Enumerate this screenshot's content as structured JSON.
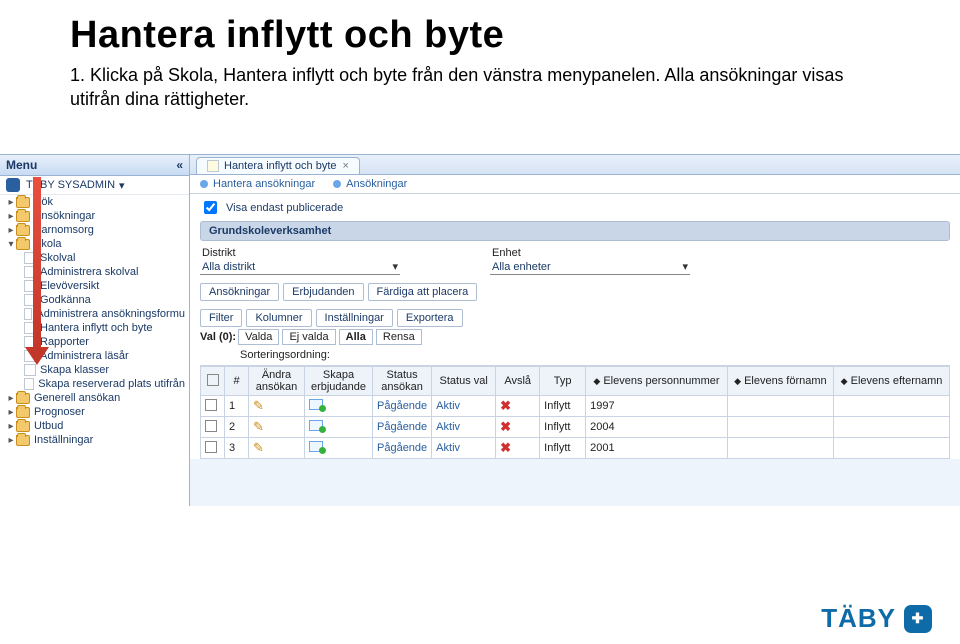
{
  "heading": "Hantera inflytt och byte",
  "paragraph": "1. Klicka på Skola, Hantera inflytt och byte från den vänstra menypanelen. Alla ansökningar visas utifrån dina rättigheter.",
  "logo_text": "TÄBY",
  "sidebar": {
    "menu_label": "Menu",
    "user": "TÄBY SYSADMIN",
    "items": [
      {
        "label": "Sök",
        "type": "folder",
        "level": 1,
        "expand": "▸"
      },
      {
        "label": "Ansökningar",
        "type": "folder",
        "level": 1,
        "expand": "▸"
      },
      {
        "label": "Barnomsorg",
        "type": "folder",
        "level": 1,
        "expand": "▸"
      },
      {
        "label": "Skola",
        "type": "folder",
        "level": 1,
        "expand": "▾"
      },
      {
        "label": "Skolval",
        "type": "leaf",
        "level": 2
      },
      {
        "label": "Administrera skolval",
        "type": "leaf",
        "level": 2
      },
      {
        "label": "Elevöversikt",
        "type": "leaf",
        "level": 2
      },
      {
        "label": "Godkänna",
        "type": "leaf",
        "level": 2
      },
      {
        "label": "Administrera ansökningsformu",
        "type": "leaf",
        "level": 2
      },
      {
        "label": "Hantera inflytt och byte",
        "type": "leaf",
        "level": 2
      },
      {
        "label": "Rapporter",
        "type": "leaf",
        "level": 2
      },
      {
        "label": "Administrera läsår",
        "type": "leaf",
        "level": 2
      },
      {
        "label": "Skapa klasser",
        "type": "leaf",
        "level": 2
      },
      {
        "label": "Skapa reserverad plats utifrån",
        "type": "leaf",
        "level": 2
      },
      {
        "label": "Generell ansökan",
        "type": "folder",
        "level": 1,
        "expand": "▸"
      },
      {
        "label": "Prognoser",
        "type": "folder",
        "level": 1,
        "expand": "▸"
      },
      {
        "label": "Utbud",
        "type": "folder",
        "level": 1,
        "expand": "▸"
      },
      {
        "label": "Inställningar",
        "type": "folder",
        "level": 1,
        "expand": "▸"
      }
    ]
  },
  "main": {
    "tab_title": "Hantera inflytt och byte",
    "subtabs": [
      "Hantera ansökningar",
      "Ansökningar"
    ],
    "cb_label": "Visa endast publicerade",
    "section": "Grundskoleverksamhet",
    "filters": {
      "distrikt_label": "Distrikt",
      "distrikt_value": "Alla distrikt",
      "enhet_label": "Enhet",
      "enhet_value": "Alla enheter"
    },
    "seg1": [
      "Ansökningar",
      "Erbjudanden",
      "Färdiga att placera"
    ],
    "seg2": [
      "Filter",
      "Kolumner",
      "Inställningar",
      "Exportera"
    ],
    "val_label": "Val (0):",
    "val_opts": [
      "Valda",
      "Ej valda",
      "Alla",
      "Rensa"
    ],
    "sort_label": "Sorteringsordning:",
    "headers": {
      "num": "#",
      "edit": "Ändra ansökan",
      "offer": "Skapa erbjudande",
      "status": "Status ansökan",
      "statusval": "Status val",
      "reject": "Avslå",
      "typ": "Typ",
      "pnr": "Elevens personnummer",
      "fname": "Elevens förnamn",
      "lname": "Elevens efternamn"
    },
    "rows": [
      {
        "num": "1",
        "status": "Pågående",
        "statusval": "Aktiv",
        "typ": "Inflytt",
        "year": "1997"
      },
      {
        "num": "2",
        "status": "Pågående",
        "statusval": "Aktiv",
        "typ": "Inflytt",
        "year": "2004"
      },
      {
        "num": "3",
        "status": "Pågående",
        "statusval": "Aktiv",
        "typ": "Inflytt",
        "year": "2001"
      }
    ]
  }
}
